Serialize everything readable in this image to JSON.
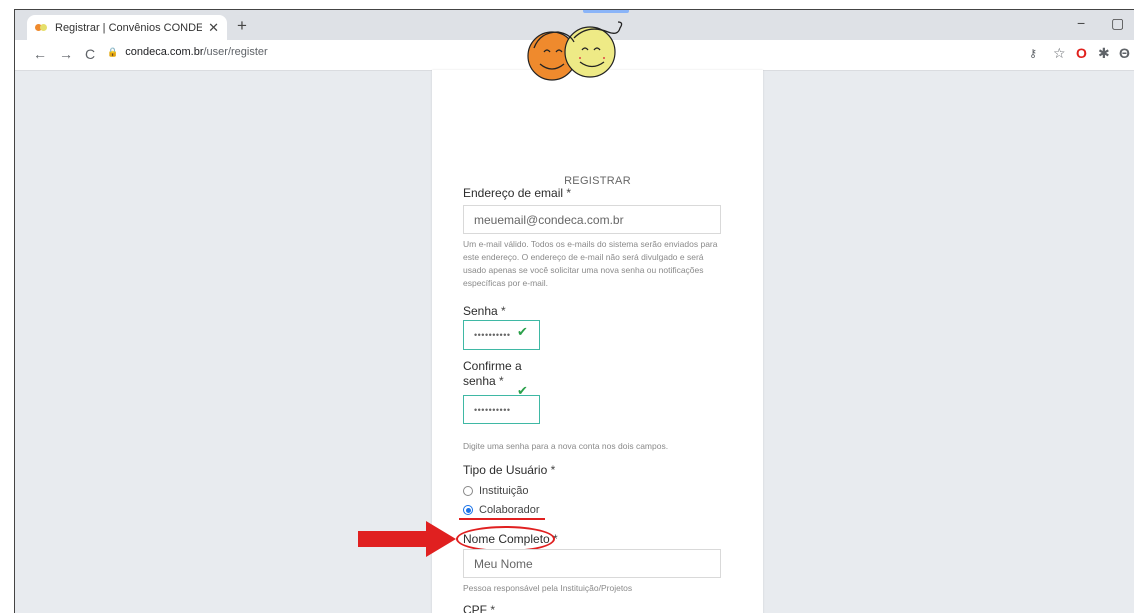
{
  "browser": {
    "tab_title": "Registrar | Convênios CONDECA",
    "tab_close": "✕",
    "new_tab": "+",
    "url_host": "condeca.com.br",
    "url_path": "/user/register",
    "win_minimize": "−",
    "win_maximize": "▢"
  },
  "form": {
    "heading": "REGISTRAR",
    "email": {
      "label": "Endereço de email",
      "required": "*",
      "value": "meuemail@condeca.com.br",
      "help": "Um e-mail válido. Todos os e-mails do sistema serão enviados para este endereço. O endereço de e-mail não será divulgado e será usado apenas se você solicitar uma nova senha ou notificações específicas por e-mail."
    },
    "password": {
      "label": "Senha",
      "required": "*",
      "value": "••••••••••"
    },
    "confirm": {
      "label_line1": "Confirme a",
      "label_line2": "senha",
      "required": "*",
      "value": "••••••••••",
      "help": "Digite uma senha para a nova conta nos dois campos."
    },
    "user_type": {
      "label": "Tipo de Usuário",
      "required": "*",
      "options": [
        "Instituição",
        "Colaborador"
      ],
      "selected": "Colaborador"
    },
    "full_name": {
      "label": "Nome Completo",
      "required": "*",
      "value": "Meu Nome",
      "help": "Pessoa responsável pela Instituição/Projetos"
    },
    "cpf": {
      "label": "CPF",
      "required": "*"
    }
  },
  "colors": {
    "annotation_red": "#e02020",
    "valid_border": "#3fb8a4",
    "check_green": "#2aa04a"
  }
}
